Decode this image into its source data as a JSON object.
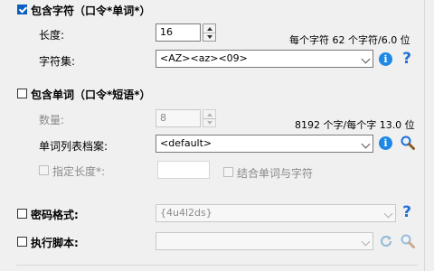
{
  "section_chars": {
    "header": "包含字符（口令*单词*）",
    "checked": true,
    "length_label": "长度:",
    "length_value": "16",
    "info_text": "每个字符 62 个字符/6.0 位",
    "charset_label": "字符集:",
    "charset_value": "<AZ><az><09>"
  },
  "section_words": {
    "header": "包含单词（口令*短语*）",
    "checked": false,
    "count_label": "数量:",
    "count_value": "8",
    "info_text": "8192 个字/每个字 13.0 位",
    "wordlist_label": "单词列表档案:",
    "wordlist_value": "<default>",
    "specify_length_label": "指定长度*:",
    "specify_length_value": "",
    "combine_label": "结合单词与字符"
  },
  "section_format": {
    "header": "密码格式:",
    "checked": false,
    "value": "{4u4l2ds}"
  },
  "section_script": {
    "header": "执行脚本:",
    "checked": false,
    "value": ""
  },
  "icons": {
    "info_glyph": "i",
    "help_glyph": "?"
  },
  "colors": {
    "accent": "#0b5fbf",
    "info_blue": "#1e88e5",
    "help_blue": "#1e6fd8",
    "disabled_text": "#8a8a8a"
  }
}
